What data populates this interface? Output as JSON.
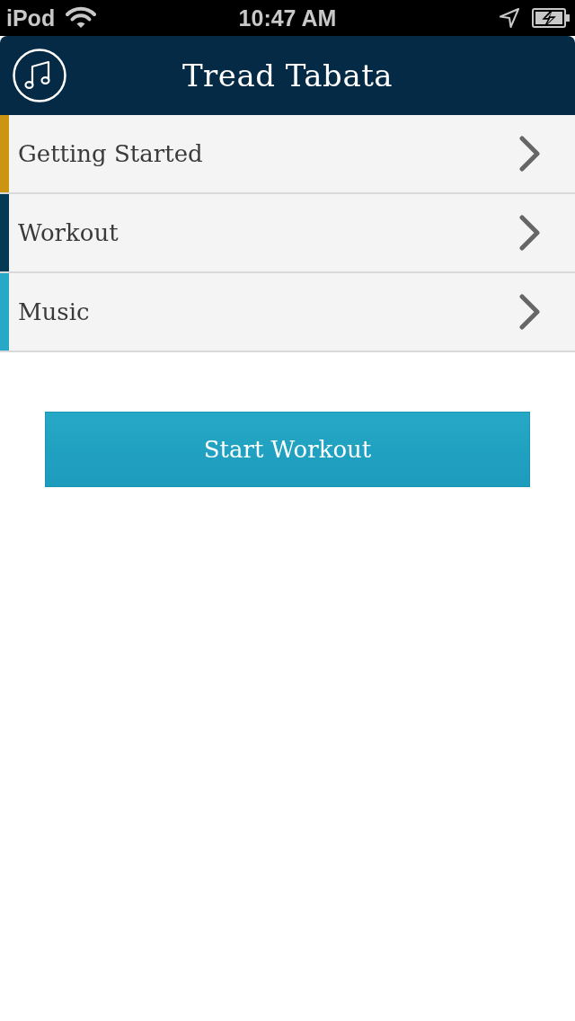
{
  "status_bar": {
    "carrier": "iPod",
    "time": "10:47 AM"
  },
  "header": {
    "title": "Tread Tabata"
  },
  "menu": [
    {
      "label": "Getting Started",
      "color": "#cc9511"
    },
    {
      "label": "Workout",
      "color": "#053a55"
    },
    {
      "label": "Music",
      "color": "#26a8c6"
    }
  ],
  "start_button": {
    "label": "Start Workout"
  }
}
